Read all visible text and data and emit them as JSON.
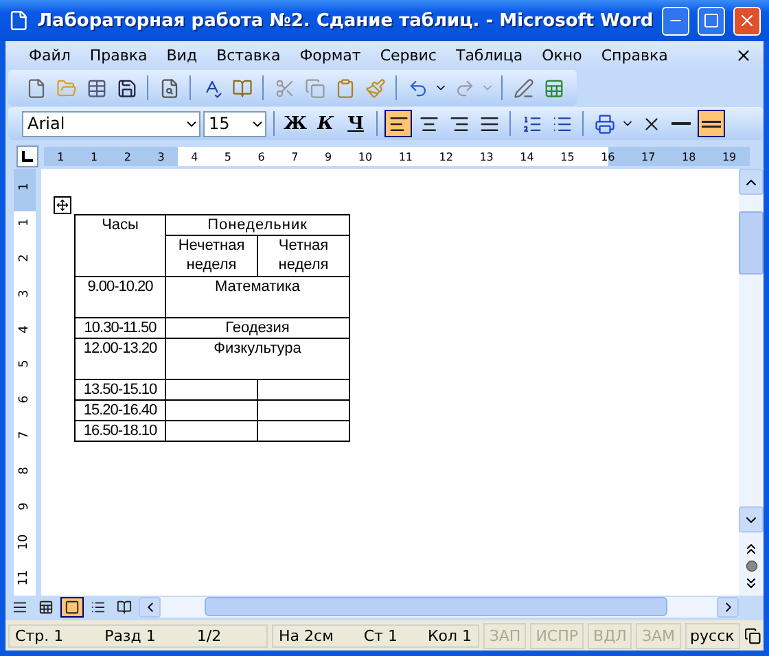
{
  "window": {
    "title": "Лабораторная работа №2. Сдание таблиц. - Microsoft Word"
  },
  "menu": [
    "Файл",
    "Правка",
    "Вид",
    "Вставка",
    "Формат",
    "Сервис",
    "Таблица",
    "Окно",
    "Справка"
  ],
  "formatting": {
    "font": "Arial",
    "size": "15",
    "buttons": [
      {
        "kind": "bold",
        "label": "Ж",
        "selected": false
      },
      {
        "kind": "italic",
        "label": "К",
        "selected": false
      },
      {
        "kind": "underline",
        "label": "Ч",
        "selected": false
      }
    ],
    "align": [
      {
        "kind": "left",
        "selected": true
      },
      {
        "kind": "center",
        "selected": false
      },
      {
        "kind": "right",
        "selected": false
      },
      {
        "kind": "justify",
        "selected": false
      }
    ]
  },
  "ruler": {
    "horizontal": [
      "1",
      "1",
      "2",
      "3",
      "4",
      "5",
      "6",
      "7",
      "9",
      "10",
      "11",
      "12",
      "13",
      "14",
      "15",
      "16",
      "17",
      "18",
      "19"
    ],
    "vertical": [
      "1",
      "1",
      "2",
      "3",
      "4",
      "5",
      "6",
      "7",
      "8",
      "9",
      "10",
      "11"
    ]
  },
  "table": {
    "header": "Часы",
    "day": "Понедельник",
    "subheaders": [
      "Нечетная неделя",
      "Четная неделя"
    ],
    "rows": [
      {
        "time": "9.00-10.20",
        "kind": "merged",
        "subject": "Математика",
        "tall": true
      },
      {
        "time": "10.30-11.50",
        "kind": "merged",
        "subject": "Геодезия",
        "tall": false
      },
      {
        "time": "12.00-13.20",
        "kind": "merged",
        "subject": "Физкультура",
        "tall": true
      },
      {
        "time": "13.50-15.10",
        "kind": "split",
        "tall": false
      },
      {
        "time": "15.20-16.40",
        "kind": "split",
        "tall": false
      },
      {
        "time": "16.50-18.10",
        "kind": "split",
        "tall": false
      }
    ]
  },
  "views": [
    {
      "kind": "normal",
      "selected": false
    },
    {
      "kind": "web",
      "selected": false
    },
    {
      "kind": "print",
      "selected": true
    },
    {
      "kind": "outline",
      "selected": false
    },
    {
      "kind": "reading",
      "selected": false
    }
  ],
  "status_bar": {
    "left": [
      "Стр. 1",
      "Разд 1",
      "1/2"
    ],
    "middle": [
      "На 2см",
      "Ст 1",
      "Кол 1"
    ],
    "modes": [
      {
        "label": "ЗАП",
        "disabled": true
      },
      {
        "label": "ИСПР",
        "disabled": true
      },
      {
        "label": "ВДЛ",
        "disabled": true
      },
      {
        "label": "ЗАМ",
        "disabled": true
      }
    ],
    "language": "русск"
  }
}
